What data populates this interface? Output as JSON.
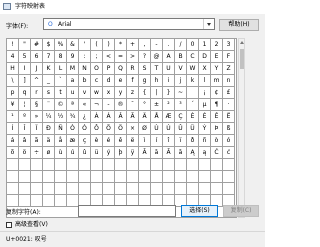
{
  "window": {
    "title": "字符映射表"
  },
  "font": {
    "label": "字体(F):",
    "selected": "Arial",
    "glyph": "O"
  },
  "help": {
    "label": "帮助(H)"
  },
  "grid": {
    "rows": [
      [
        "!",
        "\"",
        "#",
        "$",
        "%",
        "&",
        "'",
        "(",
        ")",
        "*",
        "+",
        ",",
        "-",
        ".",
        "/",
        "0",
        "1",
        "2",
        "3",
        ""
      ],
      [
        "4",
        "5",
        "6",
        "7",
        "8",
        "9",
        ":",
        ";",
        "<",
        "=",
        ">",
        "?",
        "@",
        "A",
        "B",
        "C",
        "D",
        "E",
        "F",
        ""
      ],
      [
        "H",
        "I",
        "J",
        "K",
        "L",
        "M",
        "N",
        "O",
        "P",
        "Q",
        "R",
        "S",
        "T",
        "U",
        "V",
        "W",
        "X",
        "Y",
        "Z",
        ""
      ],
      [
        "\\",
        "]",
        "^",
        "_",
        "`",
        "a",
        "b",
        "c",
        "d",
        "e",
        "f",
        "g",
        "h",
        "i",
        "j",
        "k",
        "l",
        "m",
        "n",
        ""
      ],
      [
        "p",
        "q",
        "r",
        "s",
        "t",
        "u",
        "v",
        "w",
        "x",
        "y",
        "z",
        "{",
        "|",
        "}",
        "~",
        "",
        "¡",
        "¢",
        "£",
        ""
      ],
      [
        "¥",
        "¦",
        "§",
        "¨",
        "©",
        "ª",
        "«",
        "¬",
        "-",
        "®",
        "¯",
        "°",
        "±",
        "²",
        "³",
        "´",
        "µ",
        "¶",
        "·",
        ""
      ],
      [
        "¹",
        "º",
        "»",
        "¼",
        "½",
        "¾",
        "¿",
        "À",
        "Á",
        "Â",
        "Ã",
        "Ä",
        "Å",
        "Æ",
        "Ç",
        "È",
        "É",
        "Ê",
        "Ë",
        ""
      ],
      [
        "Í",
        "Î",
        "Ï",
        "Ð",
        "Ñ",
        "Ò",
        "Ó",
        "Ô",
        "Õ",
        "Ö",
        "×",
        "Ø",
        "Ù",
        "Ú",
        "Û",
        "Ü",
        "Ý",
        "Þ",
        "ß",
        ""
      ],
      [
        "á",
        "â",
        "ã",
        "ä",
        "å",
        "æ",
        "ç",
        "è",
        "é",
        "ê",
        "ë",
        "ì",
        "í",
        "î",
        "ï",
        "ð",
        "ñ",
        "ò",
        "ó",
        ""
      ],
      [
        "õ",
        "ö",
        "÷",
        "ø",
        "ù",
        "ú",
        "û",
        "ü",
        "ý",
        "þ",
        "ÿ",
        "Ā",
        "ā",
        "Ă",
        "ă",
        "Ą",
        "ą",
        "Ć",
        "ć",
        ""
      ],
      [
        "",
        "",
        "",
        "",
        "",
        "",
        "",
        "",
        "",
        "",
        "",
        "",
        "",
        "",
        "",
        "",
        "",
        "",
        "",
        ""
      ],
      [
        "",
        "",
        "",
        "",
        "",
        "",
        "",
        "",
        "",
        "",
        "",
        "",
        "",
        "",
        "",
        "",
        "",
        "",
        "",
        ""
      ],
      [
        "",
        "",
        "",
        "",
        "",
        "",
        "",
        "",
        "",
        "",
        "",
        "",
        "",
        "",
        "",
        "",
        "",
        "",
        "",
        ""
      ],
      [
        "",
        "",
        "",
        "",
        "",
        "",
        "",
        "",
        "",
        "",
        "",
        "",
        "",
        "",
        "",
        "",
        "",
        "",
        "",
        ""
      ]
    ]
  },
  "copy": {
    "label": "复制字符(A):",
    "value": "",
    "select_label": "选择(S)",
    "copy_label": "复制(C)"
  },
  "advanced": {
    "label": "高级查看(V)",
    "checked": false
  },
  "status": {
    "text": "U+0021: 叹号"
  },
  "colors": {
    "accent": "#0078d7",
    "glyph": "#2b6bd6"
  },
  "icons": {
    "app": "charmap-icon",
    "dropdown": "chevron-down-icon"
  }
}
